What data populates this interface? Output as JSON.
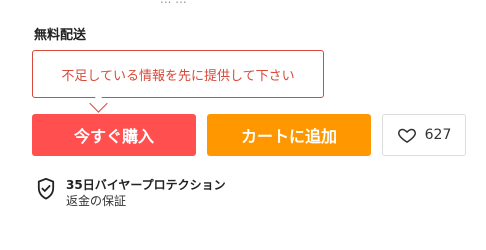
{
  "top_cut_text": "... ...",
  "shipping": {
    "title": "無料配送",
    "detail_partial": "・ ・ ・"
  },
  "tooltip": {
    "message": "不足している情報を先に提供して下さい"
  },
  "actions": {
    "buy_now_label": "今すぐ購入",
    "add_to_cart_label": "カートに追加",
    "wishlist_count": "627"
  },
  "protection": {
    "title": "35日バイヤープロテクション",
    "subtitle": "返金の保証"
  },
  "colors": {
    "buy_now": "#ff4f4f",
    "add_to_cart": "#ff9800",
    "tooltip_border": "#d84a3a"
  },
  "icons": {
    "wishlist": "heart-icon",
    "protection": "shield-check-icon"
  }
}
